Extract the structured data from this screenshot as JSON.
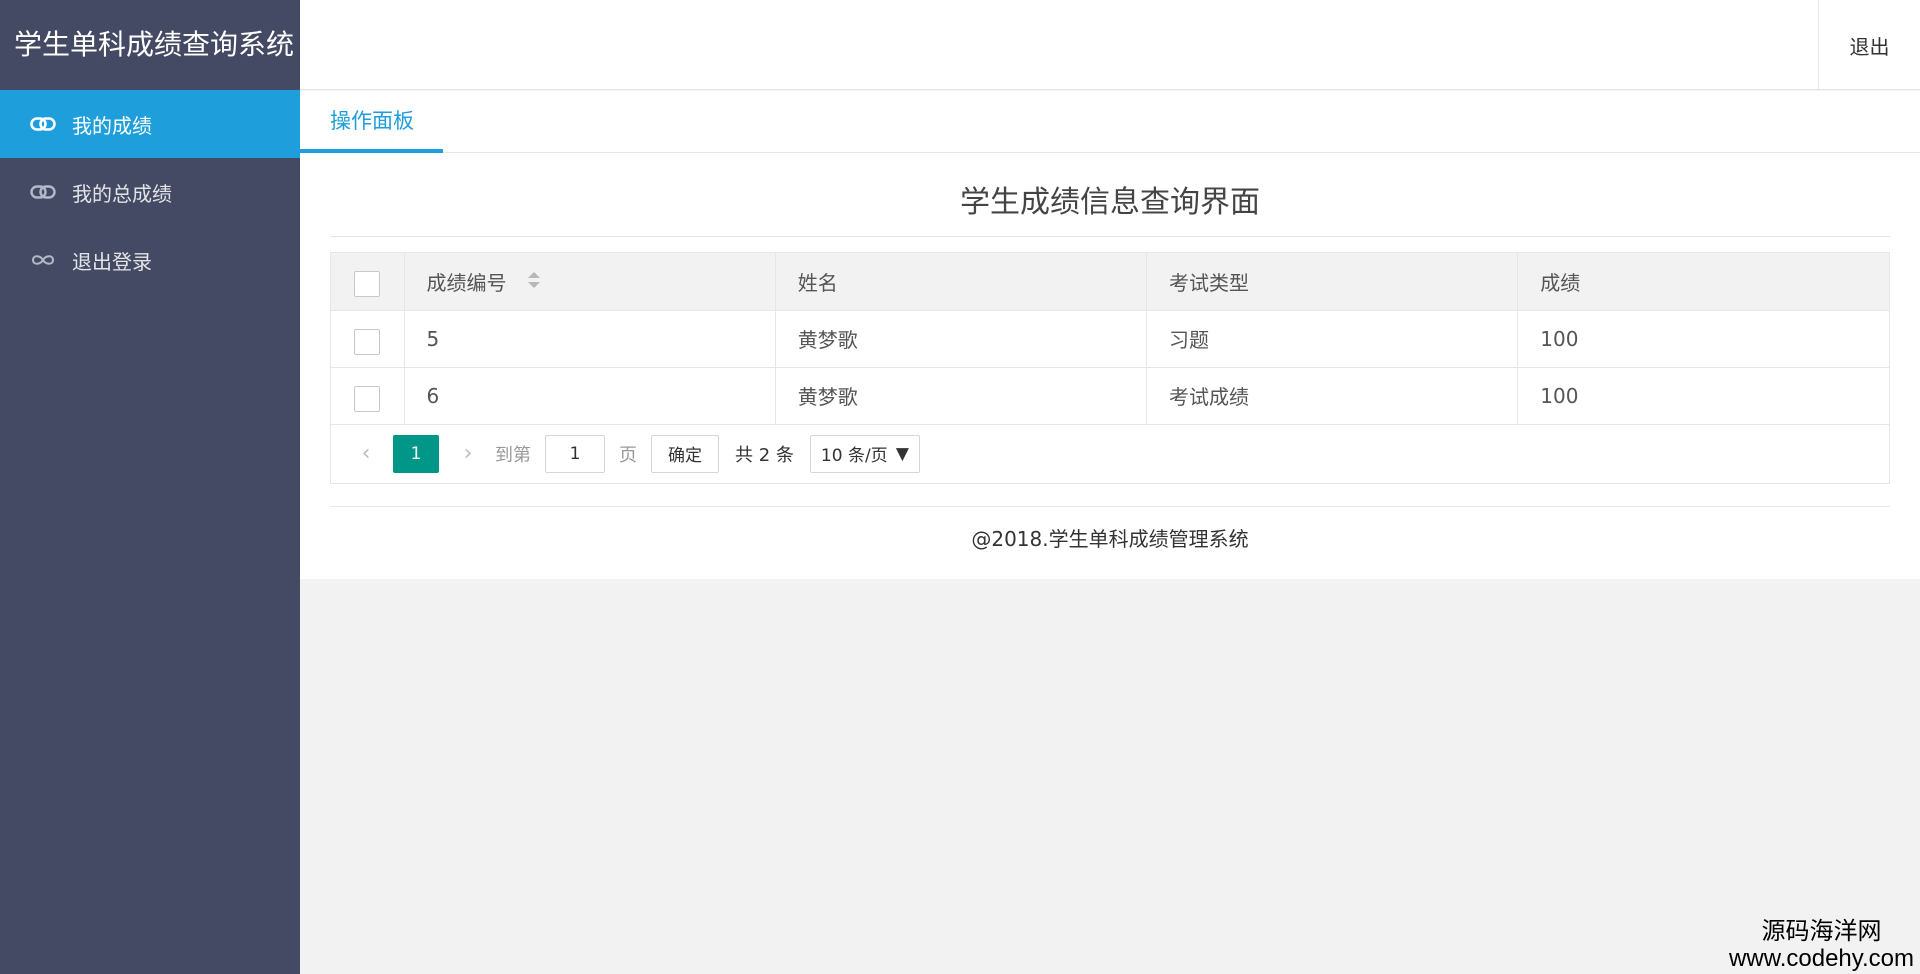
{
  "app": {
    "title": "学生单科成绩查询系统"
  },
  "sidebar": {
    "items": [
      {
        "label": "我的成绩",
        "icon": "link-icon",
        "active": true
      },
      {
        "label": "我的总成绩",
        "icon": "link-icon",
        "active": false
      },
      {
        "label": "退出登录",
        "icon": "infinity-icon",
        "active": false
      }
    ]
  },
  "header": {
    "logout_label": "退出"
  },
  "tabs": [
    {
      "label": "操作面板",
      "active": true
    }
  ],
  "main": {
    "title": "学生成绩信息查询界面"
  },
  "table": {
    "columns": [
      "成绩编号",
      "姓名",
      "考试类型",
      "成绩"
    ],
    "rows": [
      {
        "id": "5",
        "name": "黄梦歌",
        "type": "习题",
        "score": "100"
      },
      {
        "id": "6",
        "name": "黄梦歌",
        "type": "考试成绩",
        "score": "100"
      }
    ]
  },
  "pager": {
    "current_page": "1",
    "goto_label": "到第",
    "goto_value": "1",
    "page_suffix": "页",
    "confirm_label": "确定",
    "total_label": "共 2 条",
    "page_size": "10 条/页"
  },
  "footer": {
    "text": "@2018.学生单科成绩管理系统"
  },
  "watermark": {
    "line1": "源码海洋网",
    "line2": "www.codehy.com"
  },
  "colors": {
    "sidebar": "#444a63",
    "accent": "#1e9fdb",
    "page_active": "#009688"
  }
}
